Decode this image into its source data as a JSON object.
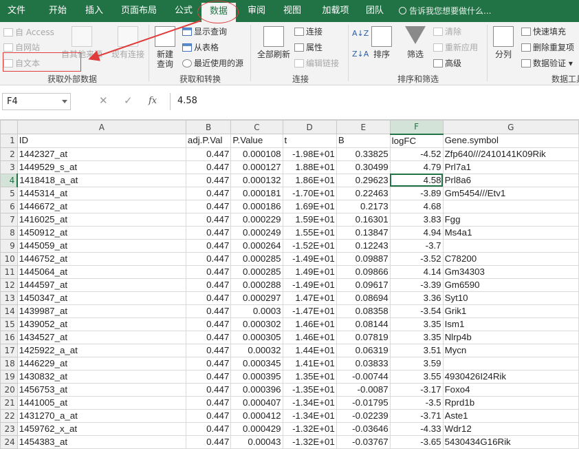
{
  "tabs": [
    {
      "label": "文件"
    },
    {
      "label": "开始"
    },
    {
      "label": "插入"
    },
    {
      "label": "页面布局"
    },
    {
      "label": "公式"
    },
    {
      "label": "数据"
    },
    {
      "label": "审阅"
    },
    {
      "label": "视图"
    },
    {
      "label": "加载项"
    },
    {
      "label": "团队"
    }
  ],
  "tell_me": "告诉我您想要做什么...",
  "ribbon": {
    "get_external": {
      "access": "自 Access",
      "web": "自网站",
      "text": "自文本",
      "other": "自其他来源",
      "existing": "现有连接",
      "group": "获取外部数据"
    },
    "transform": {
      "new_query": "新建\n查询",
      "show_queries": "显示查询",
      "from_table": "从表格",
      "recent": "最近使用的源",
      "group": "获取和转换"
    },
    "connections": {
      "refresh_all": "全部刷新",
      "connections": "连接",
      "properties": "属性",
      "edit_links": "编辑链接",
      "group": "连接"
    },
    "sort_filter": {
      "sort": "排序",
      "filter": "筛选",
      "clear": "清除",
      "reapply": "重新应用",
      "advanced": "高级",
      "group": "排序和筛选"
    },
    "data_tools": {
      "split": "分列",
      "flash_fill": "快速填充",
      "remove_dup": "删除重复项",
      "validation": "数据验证",
      "group": "数据工具"
    }
  },
  "formula_bar": {
    "name_box": "F4",
    "cancel": "✕",
    "enter": "✓",
    "fx": "fx",
    "value": "4.58"
  },
  "columns": [
    "A",
    "B",
    "C",
    "D",
    "E",
    "F",
    "G"
  ],
  "rows": [
    {
      "n": "1",
      "c": [
        "ID",
        "adj.P.Val",
        "P.Value",
        "t",
        "B",
        "logFC",
        "Gene.symbol"
      ]
    },
    {
      "n": "2",
      "c": [
        "1442327_at",
        "0.447",
        "0.000108",
        "-1.98E+01",
        "0.33825",
        "-4.52",
        "Zfp640///2410141K09Rik"
      ]
    },
    {
      "n": "3",
      "c": [
        "1449529_s_at",
        "0.447",
        "0.000127",
        "1.88E+01",
        "0.30499",
        "4.79",
        "Prl7a1"
      ]
    },
    {
      "n": "4",
      "c": [
        "1418418_a_at",
        "0.447",
        "0.000132",
        "1.86E+01",
        "0.29623",
        "4.58",
        "Prl8a6"
      ]
    },
    {
      "n": "5",
      "c": [
        "1445314_at",
        "0.447",
        "0.000181",
        "-1.70E+01",
        "0.22463",
        "-3.89",
        "Gm5454///Etv1"
      ]
    },
    {
      "n": "6",
      "c": [
        "1446672_at",
        "0.447",
        "0.000186",
        "1.69E+01",
        "0.2173",
        "4.68",
        ""
      ]
    },
    {
      "n": "7",
      "c": [
        "1416025_at",
        "0.447",
        "0.000229",
        "1.59E+01",
        "0.16301",
        "3.83",
        "Fgg"
      ]
    },
    {
      "n": "8",
      "c": [
        "1450912_at",
        "0.447",
        "0.000249",
        "1.55E+01",
        "0.13847",
        "4.94",
        "Ms4a1"
      ]
    },
    {
      "n": "9",
      "c": [
        "1445059_at",
        "0.447",
        "0.000264",
        "-1.52E+01",
        "0.12243",
        "-3.7",
        ""
      ]
    },
    {
      "n": "10",
      "c": [
        "1446752_at",
        "0.447",
        "0.000285",
        "-1.49E+01",
        "0.09887",
        "-3.52",
        "C78200"
      ]
    },
    {
      "n": "11",
      "c": [
        "1445064_at",
        "0.447",
        "0.000285",
        "1.49E+01",
        "0.09866",
        "4.14",
        "Gm34303"
      ]
    },
    {
      "n": "12",
      "c": [
        "1444597_at",
        "0.447",
        "0.000288",
        "-1.49E+01",
        "0.09617",
        "-3.39",
        "Gm6590"
      ]
    },
    {
      "n": "13",
      "c": [
        "1450347_at",
        "0.447",
        "0.000297",
        "1.47E+01",
        "0.08694",
        "3.36",
        "Syt10"
      ]
    },
    {
      "n": "14",
      "c": [
        "1439987_at",
        "0.447",
        "0.0003",
        "-1.47E+01",
        "0.08358",
        "-3.54",
        "Grik1"
      ]
    },
    {
      "n": "15",
      "c": [
        "1439052_at",
        "0.447",
        "0.000302",
        "1.46E+01",
        "0.08144",
        "3.35",
        "Ism1"
      ]
    },
    {
      "n": "16",
      "c": [
        "1434527_at",
        "0.447",
        "0.000305",
        "1.46E+01",
        "0.07819",
        "3.35",
        "Nlrp4b"
      ]
    },
    {
      "n": "17",
      "c": [
        "1425922_a_at",
        "0.447",
        "0.00032",
        "1.44E+01",
        "0.06319",
        "3.51",
        "Mycn"
      ]
    },
    {
      "n": "18",
      "c": [
        "1446229_at",
        "0.447",
        "0.000345",
        "1.41E+01",
        "0.03833",
        "3.59",
        ""
      ]
    },
    {
      "n": "19",
      "c": [
        "1430832_at",
        "0.447",
        "0.000395",
        "1.35E+01",
        "-0.00744",
        "3.55",
        "4930426I24Rik"
      ]
    },
    {
      "n": "20",
      "c": [
        "1456753_at",
        "0.447",
        "0.000396",
        "-1.35E+01",
        "-0.0087",
        "-3.17",
        "Foxo4"
      ]
    },
    {
      "n": "21",
      "c": [
        "1441005_at",
        "0.447",
        "0.000407",
        "-1.34E+01",
        "-0.01795",
        "-3.5",
        "Rprd1b"
      ]
    },
    {
      "n": "22",
      "c": [
        "1431270_a_at",
        "0.447",
        "0.000412",
        "-1.34E+01",
        "-0.02239",
        "-3.71",
        "Aste1"
      ]
    },
    {
      "n": "23",
      "c": [
        "1459762_x_at",
        "0.447",
        "0.000429",
        "-1.32E+01",
        "-0.03646",
        "-4.33",
        "Wdr12"
      ]
    },
    {
      "n": "24",
      "c": [
        "1454383_at",
        "0.447",
        "0.00043",
        "-1.32E+01",
        "-0.03767",
        "-3.65",
        "5430434G16Rik"
      ]
    }
  ],
  "selection": {
    "row": 4,
    "col": "F"
  },
  "colors": {
    "accent": "#217346",
    "annotation": "#e03c3c"
  }
}
